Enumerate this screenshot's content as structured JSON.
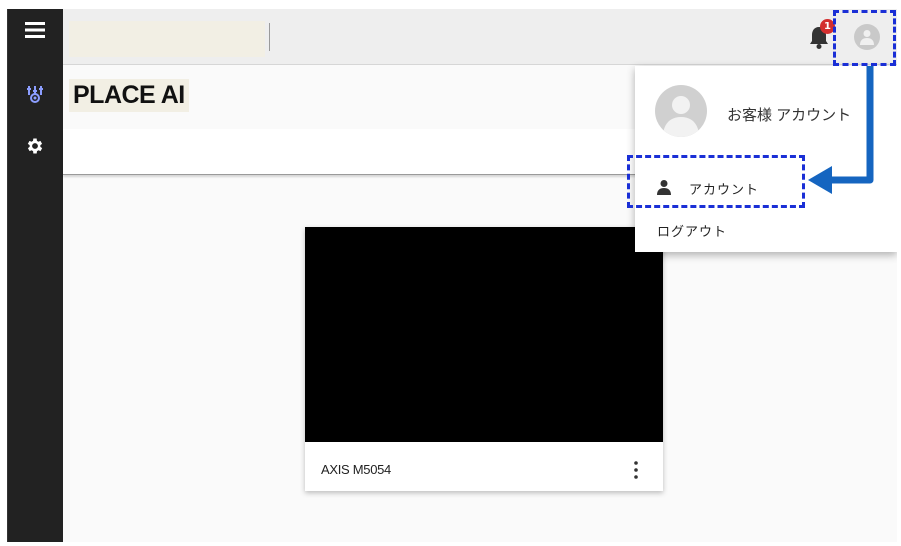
{
  "app": {
    "title": "PLACE AI"
  },
  "topbar": {
    "search_value": "",
    "notification_count": "1"
  },
  "camera_card": {
    "name": "AXIS M5054"
  },
  "user_menu": {
    "username": "お客様 アカウント",
    "account_label": "アカウント",
    "logout_label": "ログアウト"
  },
  "icons": {
    "menu": "hamburger-menu-icon",
    "sensor": "sensor-icon",
    "settings": "gear-icon",
    "notifications": "bell-icon",
    "user": "person-icon",
    "more": "more-vertical-icon"
  },
  "colors": {
    "sidebar_bg": "#222222",
    "topbar_bg": "#eeeeee",
    "accent_blue": "#1a2fd6",
    "arrow_blue": "#1565c0",
    "badge_red": "#d32f2f",
    "sensor_icon": "#8c9eff"
  }
}
